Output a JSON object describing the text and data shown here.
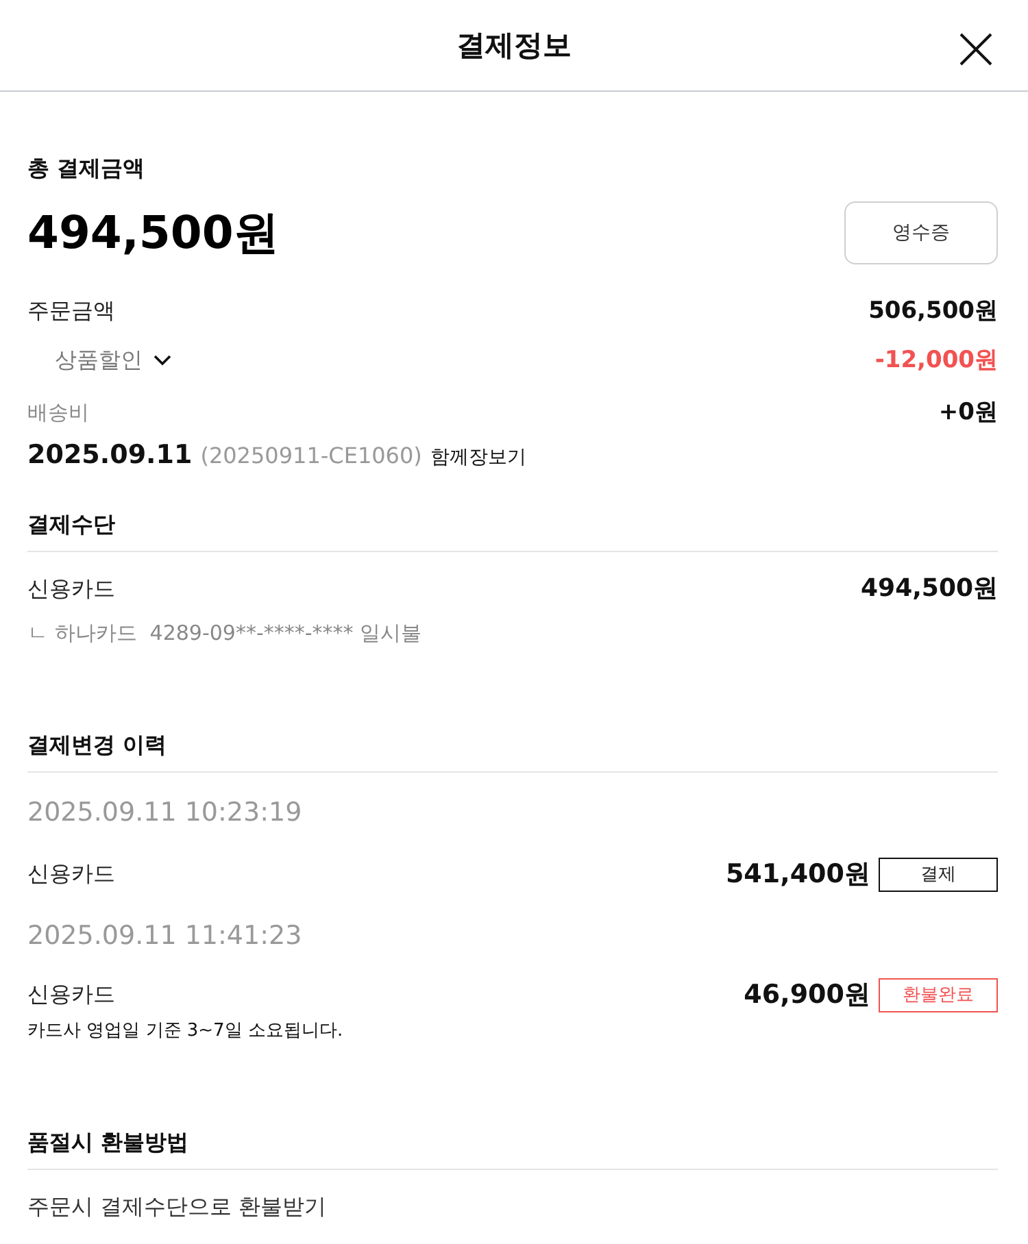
{
  "header": {
    "title": "결제정보"
  },
  "total": {
    "label": "총 결제금액",
    "amount": "494,500원",
    "receipt_button": "영수증"
  },
  "breakdown": [
    {
      "kind": "main",
      "label": "주문금액",
      "value": "506,500원"
    },
    {
      "kind": "discount",
      "label": "상품할인",
      "value": "-12,000원",
      "expanded": false
    },
    {
      "kind": "fee",
      "label": "배송비",
      "value": "+0원"
    }
  ],
  "order": {
    "date": "2025.09.11",
    "number": "(20250911-CE1060)",
    "tag": "함께장보기"
  },
  "payment_method": {
    "title": "결제수단",
    "method": "신용카드",
    "amount": "494,500원",
    "detail": "ㄴ 하나카드  4289-09**-****-**** 일시불"
  },
  "history": {
    "title": "결제변경 이력",
    "entries": [
      {
        "time": "2025.09.11 10:23:19",
        "method": "신용카드",
        "amount": "541,400원",
        "status": "결제",
        "kind": "payment"
      },
      {
        "time": "2025.09.11 11:41:23",
        "method": "신용카드",
        "amount": "46,900원",
        "status": "환불완료",
        "kind": "refund",
        "note": "카드사 영업일 기준 3~7일 소요됩니다."
      }
    ]
  },
  "refund_policy": {
    "title": "품절시 환불방법",
    "text": "주문시 결제수단으로 환불받기"
  }
}
